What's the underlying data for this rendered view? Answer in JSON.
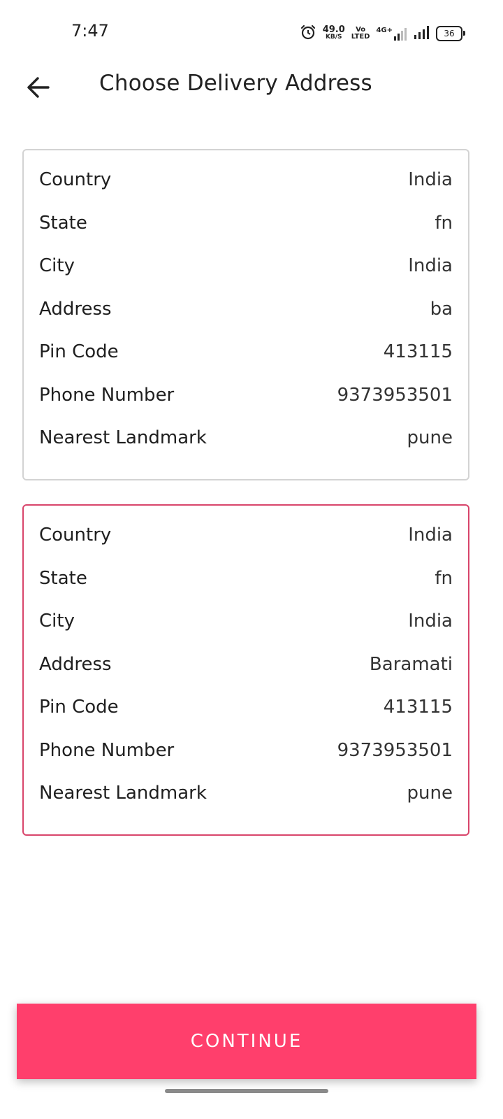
{
  "status_bar": {
    "time": "7:47",
    "net_speed_value": "49.0",
    "net_speed_unit": "KB/S",
    "volte_top": "Vo",
    "volte_bottom": "LTED",
    "network_type": "4G+",
    "battery": "36"
  },
  "header": {
    "title": "Choose Delivery Address"
  },
  "addresses": [
    {
      "selected": false,
      "fields": [
        {
          "label": "Country",
          "value": "India"
        },
        {
          "label": "State",
          "value": "fn"
        },
        {
          "label": "City",
          "value": "India"
        },
        {
          "label": "Address",
          "value": "ba"
        },
        {
          "label": "Pin Code",
          "value": "413115"
        },
        {
          "label": "Phone Number",
          "value": "9373953501"
        },
        {
          "label": "Nearest Landmark",
          "value": "pune"
        }
      ]
    },
    {
      "selected": true,
      "fields": [
        {
          "label": "Country",
          "value": "India"
        },
        {
          "label": "State",
          "value": "fn"
        },
        {
          "label": "City",
          "value": "India"
        },
        {
          "label": "Address",
          "value": "Baramati"
        },
        {
          "label": "Pin Code",
          "value": "413115"
        },
        {
          "label": "Phone Number",
          "value": "9373953501"
        },
        {
          "label": "Nearest Landmark",
          "value": "pune"
        }
      ]
    }
  ],
  "continue_label": "CONTINUE",
  "colors": {
    "accent": "#ff3f6c",
    "selected_border": "#d8456b",
    "card_border": "#d3d3d3"
  }
}
